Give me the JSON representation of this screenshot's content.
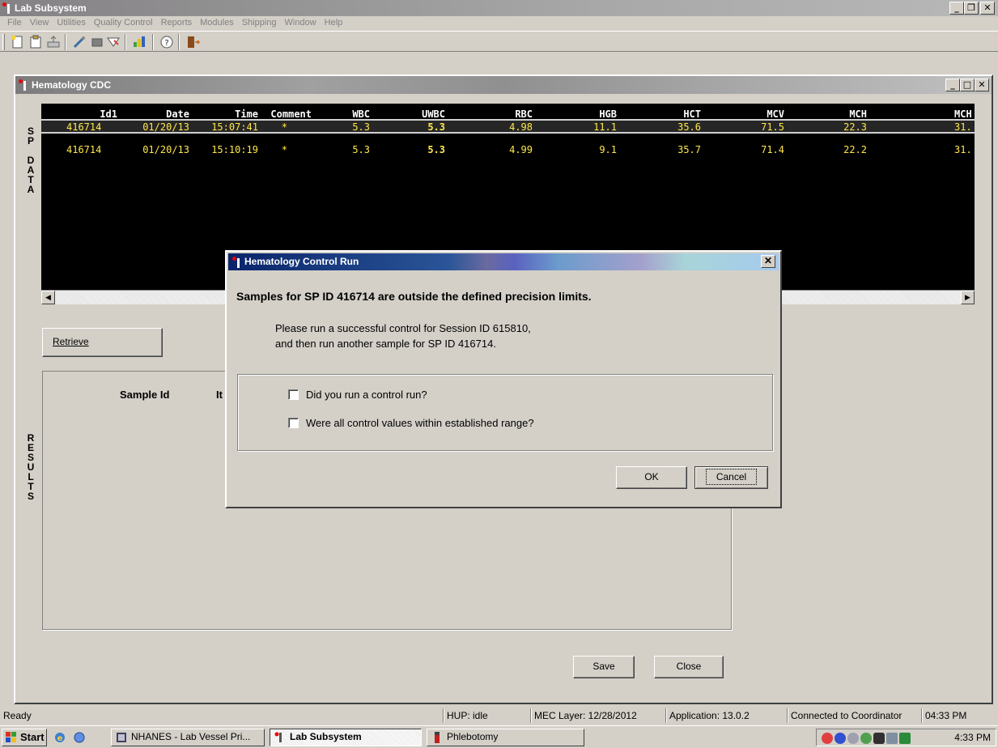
{
  "app": {
    "title": "Lab Subsystem"
  },
  "menu": [
    {
      "label": "File"
    },
    {
      "label": "View"
    },
    {
      "label": "Utilities"
    },
    {
      "label": "Quality Control"
    },
    {
      "label": "Reports"
    },
    {
      "label": "Modules"
    },
    {
      "label": "Shipping"
    },
    {
      "label": "Window"
    },
    {
      "label": "Help"
    }
  ],
  "window": {
    "title": "Hematology CDC"
  },
  "side_labels": {
    "sp": "S\nP",
    "data": "D\nA\nT\nA",
    "results": "R\nE\nS\nU\nL\nT\nS"
  },
  "grid": {
    "headers": [
      "Id1",
      "Date",
      "Time",
      "Comment",
      "WBC",
      "UWBC",
      "RBC",
      "HGB",
      "HCT",
      "MCV",
      "MCH",
      "MCH"
    ],
    "rows": [
      [
        "416714",
        "01/20/13",
        "15:07:41",
        "*",
        "5.3",
        "5.3",
        "4.98",
        "11.1",
        "35.6",
        "71.5",
        "22.3",
        "31."
      ],
      [
        "416714",
        "01/20/13",
        "15:10:19",
        "*",
        "5.3",
        "5.3",
        "4.99",
        "9.1",
        "35.7",
        "71.4",
        "22.2",
        "31."
      ]
    ]
  },
  "buttons": {
    "retrieve": "Retrieve",
    "save": "Save",
    "close": "Close",
    "ok": "OK",
    "cancel": "Cancel"
  },
  "results": {
    "col_sample_id": "Sample Id",
    "col_it": "It"
  },
  "dialog": {
    "title": "Hematology Control Run",
    "message": "Samples for SP ID 416714 are outside the defined precision limits.",
    "instruction_line1": "Please run a successful control for Session ID 615810,",
    "instruction_line2": "and then run another sample for SP ID 416714.",
    "check1": "Did you run a control run?",
    "check2": "Were all control values within established range?"
  },
  "status": {
    "ready": "Ready",
    "hup": "HUP: idle",
    "mec_layer": "MEC Layer: 12/28/2012",
    "application": "Application: 13.0.2",
    "connection": "Connected to Coordinator",
    "time": "04:33 PM"
  },
  "taskbar": {
    "start": "Start",
    "tasks": [
      {
        "label": "NHANES - Lab Vessel Pri..."
      },
      {
        "label": "Lab Subsystem"
      },
      {
        "label": "Phlebotomy"
      }
    ],
    "clock": "4:33 PM"
  }
}
